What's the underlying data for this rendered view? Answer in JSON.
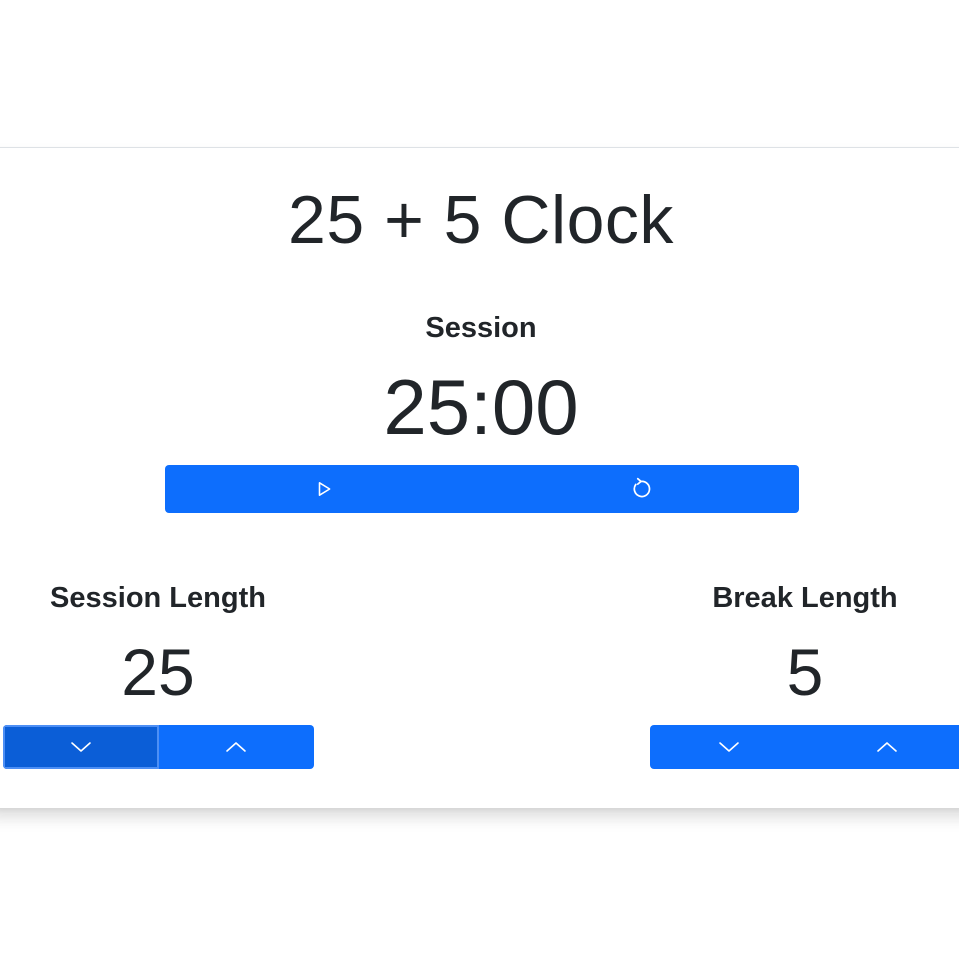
{
  "app": {
    "title": "25 + 5 Clock"
  },
  "timer": {
    "label": "Session",
    "time_left": "25:00",
    "start_stop_icon": "play-icon",
    "reset_icon": "reset-icon"
  },
  "session": {
    "label": "Session Length",
    "value": "25",
    "decrement_icon": "chevron-down-icon",
    "increment_icon": "chevron-up-icon"
  },
  "break": {
    "label": "Break Length",
    "value": "5",
    "decrement_icon": "chevron-down-icon",
    "increment_icon": "chevron-up-icon"
  },
  "colors": {
    "primary": "#0d6efd",
    "primary_active": "#0b5ed7",
    "text": "#212529",
    "icon": "#ffffff"
  }
}
